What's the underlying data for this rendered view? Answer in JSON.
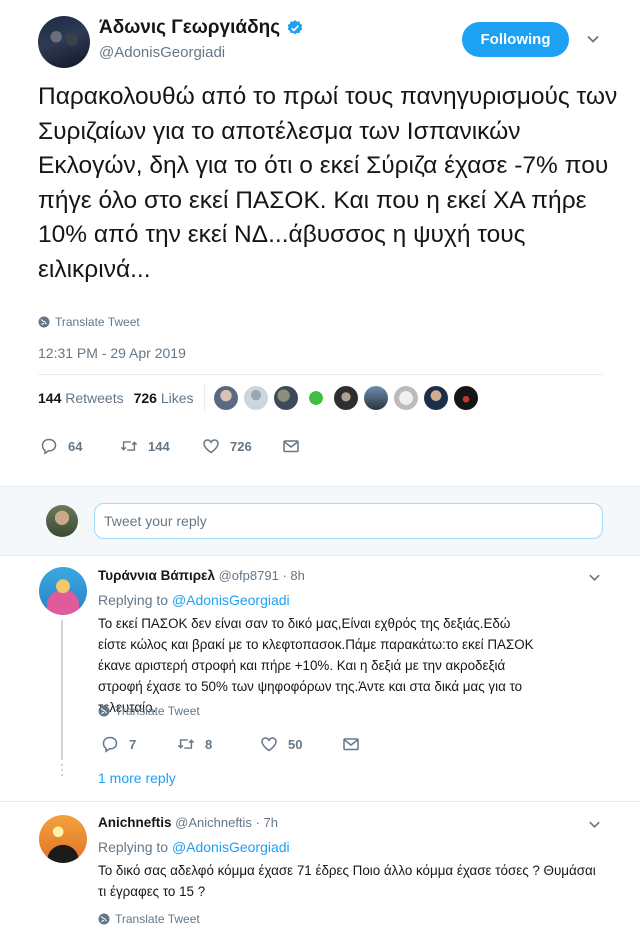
{
  "author": {
    "name": "Άδωνις Γεωργιάδης",
    "handle": "@AdonisGeorgiadi",
    "verified": true,
    "follow_label": "Following"
  },
  "tweet": {
    "text": "Παρακολουθώ από το πρωί τους πανηγυρισμούς των Συριζαίων για το αποτέλεσμα των Ισπανικών Εκλογών, δηλ για το ότι ο εκεί Σύριζα έχασε -7% που πήγε όλο στο εκεί ΠΑΣΟΚ. Και που η εκεί ΧΑ πήρε 10% από την εκεί ΝΔ...άβυσσος η ψυχή τους ειλικρινά...",
    "translate_label": "Translate Tweet",
    "timestamp": "12:31 PM - 29 Apr 2019",
    "retweets_count": "144",
    "retweets_label": "Retweets",
    "likes_count": "726",
    "likes_label": "Likes",
    "actions": {
      "replies": "64",
      "retweets": "144",
      "likes": "726"
    }
  },
  "reply_box": {
    "placeholder": "Tweet your reply"
  },
  "replies": [
    {
      "name": "Τυράννια Βάπιρελ",
      "handle": "@ofp8791",
      "time": "· 8h",
      "replying_prefix": "Replying to",
      "replying_to": "@AdonisGeorgiadi",
      "text": "Το εκεί ΠΑΣΟΚ δεν είναι σαν το δικό μας,Είναι εχθρός της δεξιάς.Εδώ είστε κώλος και βρακί με το κλεφτοπασοκ.Πάμε παρακάτω:το εκεί ΠΑΣΟΚ έκανε αριστερή στροφή και πήρε +10%. Και η δεξιά με την ακροδεξιά στροφή έχασε το 50% των ψηφοφόρων της.Άντε και στα δικά μας για το τελευταίο.",
      "translate_label": "Translate Tweet",
      "replies": "7",
      "retweets": "8",
      "likes": "50",
      "more_replies": "1 more reply"
    },
    {
      "name": "Anichneftis",
      "handle": "@Anichneftis",
      "time": "· 7h",
      "replying_prefix": "Replying to",
      "replying_to": "@AdonisGeorgiadi",
      "text": "Το δικό σας αδελφό κόμμα έχασε 71 έδρες Ποιο άλλο κόμμα έχασε τόσες ? Θυμάσαι τι έγραφες το 15 ?",
      "translate_label": "Translate Tweet"
    }
  ],
  "colors": {
    "accent": "#1da1f2",
    "text": "#14171a",
    "secondary": "#657786",
    "border": "#e6ecf0"
  }
}
